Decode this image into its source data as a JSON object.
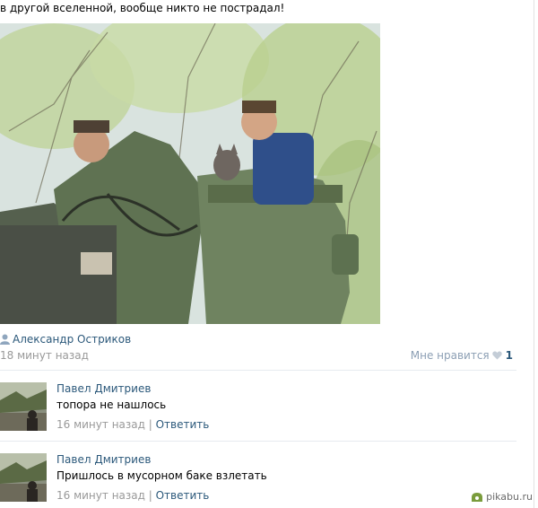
{
  "post": {
    "text": "в другой вселенной, вообще никто не пострадал!",
    "author": "Александр Остриков",
    "time": "18 минут назад",
    "like_label": "Мне нравится",
    "like_count": "1"
  },
  "comments": [
    {
      "author": "Павел Дмитриев",
      "text": "топора не нашлось",
      "time": "16 минут назад",
      "reply_label": "Ответить"
    },
    {
      "author": "Павел Дмитриев",
      "text": "Пришлось в мусорном баке взлетать",
      "time": "16 минут назад",
      "reply_label": "Ответить"
    }
  ],
  "watermark": "pikabu.ru",
  "colors": {
    "link": "#2b587a",
    "muted": "#999999",
    "divider": "#e7ebf0"
  }
}
